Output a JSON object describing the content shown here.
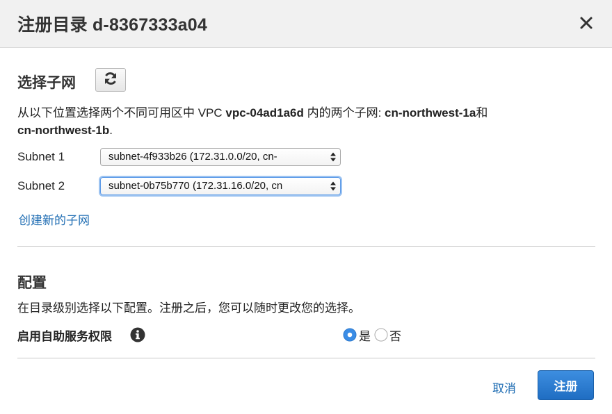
{
  "dialog": {
    "title": "注册目录 d-8367333a04"
  },
  "subnet_section": {
    "title": "选择子网",
    "desc_prefix": "从以下位置选择两个不同可用区中 VPC ",
    "vpc_id": "vpc-04ad1a6d",
    "desc_middle": " 内的两个子网: ",
    "az1": "cn-northwest-1a",
    "desc_and": "和",
    "az2": "cn-northwest-1b",
    "desc_end": ".",
    "subnet1_label": "Subnet 1",
    "subnet1_value": "subnet-4f933b26 (172.31.0.0/20, cn-",
    "subnet2_label": "Subnet 2",
    "subnet2_value": "subnet-0b75b770 (172.31.16.0/20, cn",
    "create_link": "创建新的子网"
  },
  "config_section": {
    "title": "配置",
    "desc": "在目录级别选择以下配置。注册之后，您可以随时更改您的选择。",
    "self_service_label": "启用自助服务权限",
    "option_yes": "是",
    "option_no": "否",
    "selected": "是"
  },
  "footer": {
    "cancel_label": "取消",
    "register_label": "注册"
  },
  "colors": {
    "link": "#1f6db3",
    "primary": "#1f6dc2",
    "radio_selected": "#3b8de6"
  }
}
